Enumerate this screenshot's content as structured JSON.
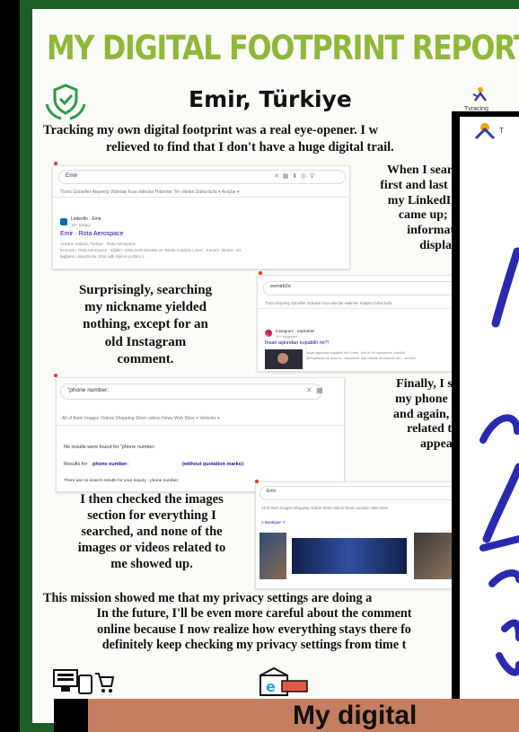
{
  "header": {
    "title": "MY DIGITAL FOOTPRINT REPORT",
    "subtitle": "Emir, Türkiye"
  },
  "text": {
    "intro_line1": "Tracking my own digital footprint was a real eye-opener. I w",
    "intro_line2": "relieved to find that I don't have a huge digital trail.",
    "right_1": [
      "When I searc",
      "first and last n",
      "my LinkedIn",
      "came up; n",
      "informati",
      "display"
    ],
    "nickname": [
      "Surprisingly, searching",
      "my nickname yielded",
      "nothing, except for an",
      "old Instagram",
      "comment."
    ],
    "right_2": [
      "Finally, I se",
      "my phone n",
      "and again, r",
      "related to",
      "appear"
    ],
    "images": [
      "I then checked the images",
      "section for everything I",
      "searched, and none of the",
      "images or videos related to",
      "me showed up."
    ],
    "conclusion": [
      "This mission showed me that my privacy settings are doing a",
      "In the future, I'll be even more careful about the comment",
      "online because I now realize how everything stays there fo",
      "definitely keep checking my privacy settings from time t"
    ]
  },
  "shot1": {
    "query": "Emir",
    "tabs": "Tümü   Görseller   Alışveriş   Videolar   Kısa videolar   Haberler   Yer siteleri   Daha fazla ▾   Araçlar ▾",
    "source": "LinkedIn · Emir",
    "source_sub": "10+ takipçi",
    "result_title": "Emir        · Rota Aerospace",
    "result_line1": "Ankara, Ankara, Türkiye · Rota Aerospace",
    "result_line2": "Deneyim: Rota Aerospace · Eğitim: ADELSAN Mesleki ve Teknik Anadolu Lisesi · Konum: 06420 · 24",
    "result_line3": "bağlantı LinkedIn'de. Emir         adlı kişinin profilini 1 ..."
  },
  "shot2": {
    "query": "eemirb2e",
    "tabs": "Tümü   Alışveriş   Görseller   Videolar   Kısa videolar   Haberler   Kitaplar   Daha fazla",
    "source": "Instagram · eapkokter",
    "source_sub": "10+ begenme",
    "result_title": "İnsan aşkından kopabilir mi?!",
    "result_line1": "İnsan aşkından kopabilir mi?! Hem. Yeni el 'Hi comments, ed#### ",
    "result_line2": "@eroplanau ne artık ez, meyrenize. Aşk üstüde ve kalecek der... devamı"
  },
  "shot3": {
    "query": "\"phone number:",
    "tabs": "All of them    Images    Videos    Shopping    Short videos    News    Web    More ▾    Vehicles ▾",
    "line1": "No results were found for \"phone number:",
    "line2_a": "Results for",
    "line2_b": "phone number:",
    "line2_c": "(without quotation marks):",
    "line3": "There are no search results for your inquiry - phone number:"
  },
  "shot4": {
    "query": "Emir",
    "tabs": "All of them   Images   Shopping   Videos   Short videos   News   Location sites   More",
    "tag": "≡ Boutique' ?"
  },
  "side_logo": {
    "label": "Tvracing"
  },
  "banner": {
    "text": "My digital"
  },
  "colors": {
    "frame": "#1f5d26",
    "title": "#8fb83a",
    "banner": "#c47e62",
    "ink_blue": "#2a2ab0"
  }
}
